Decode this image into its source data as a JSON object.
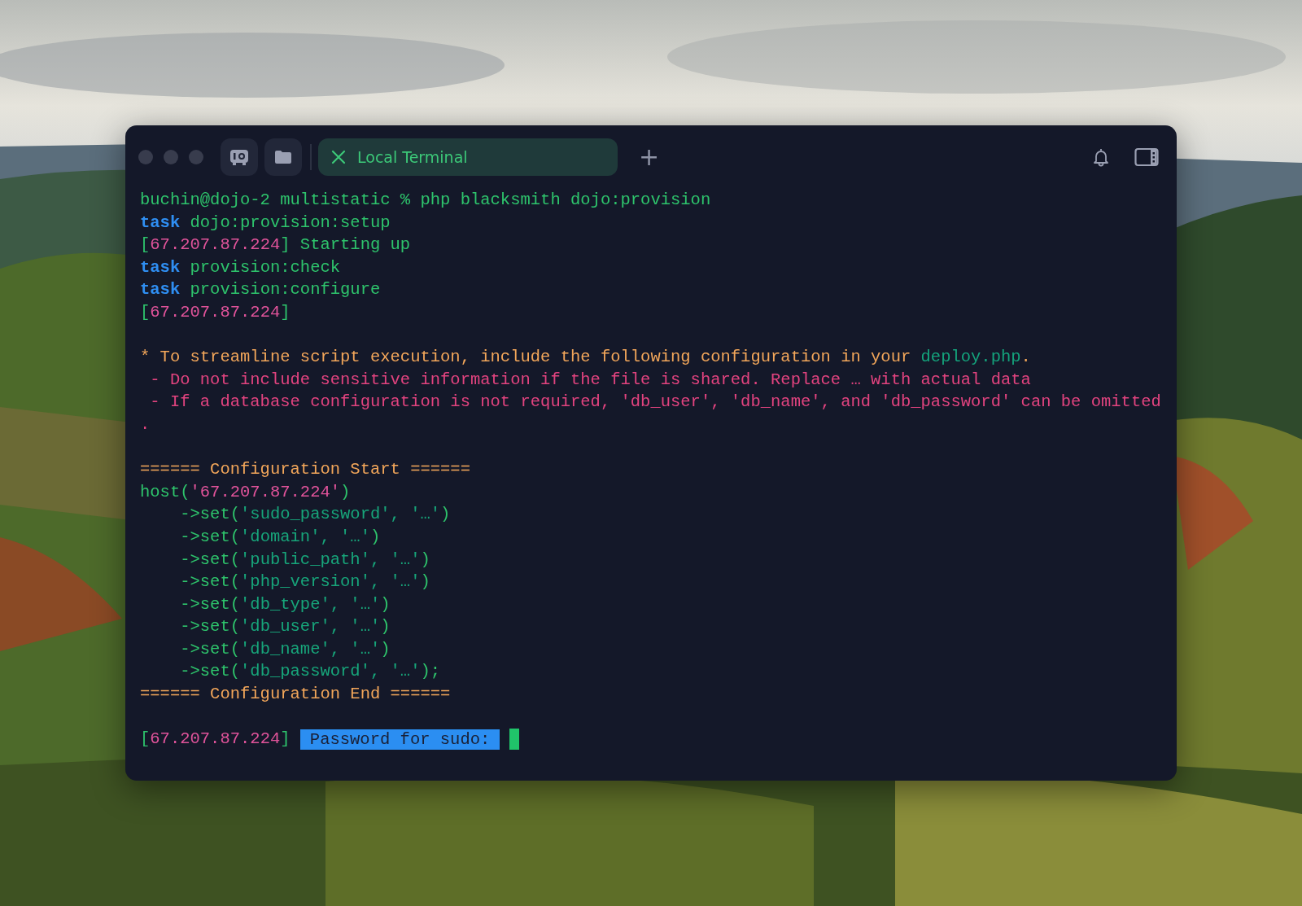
{
  "tab": {
    "label": "Local Terminal",
    "selected": true
  },
  "new_tab": {
    "label": "+"
  },
  "lines": [
    {
      "kind": "output",
      "segments": [
        {
          "kind": "text",
          "text": "buchin@dojo-2 multistatic % php blacksmith dojo:provision"
        }
      ]
    },
    {
      "kind": "output",
      "segments": [
        {
          "kind": "keyword",
          "text": "task"
        },
        {
          "kind": "text",
          "text": " dojo:provision:setup"
        }
      ]
    },
    {
      "kind": "output",
      "segments": [
        {
          "kind": "text",
          "text": "["
        },
        {
          "kind": "ip",
          "text": "67.207.87.224"
        },
        {
          "kind": "text",
          "text": "] Starting up"
        }
      ]
    },
    {
      "kind": "output",
      "segments": [
        {
          "kind": "keyword",
          "text": "task"
        },
        {
          "kind": "text",
          "text": " provision:check"
        }
      ]
    },
    {
      "kind": "output",
      "segments": [
        {
          "kind": "keyword",
          "text": "task"
        },
        {
          "kind": "text",
          "text": " provision:configure"
        }
      ]
    },
    {
      "kind": "output",
      "segments": [
        {
          "kind": "text",
          "text": "["
        },
        {
          "kind": "ip",
          "text": "67.207.87.224"
        },
        {
          "kind": "text",
          "text": "]"
        }
      ]
    },
    {
      "kind": "blank"
    },
    {
      "kind": "output",
      "segments": [
        {
          "kind": "notice",
          "text": "* To streamline script execution, include the following configuration in your "
        },
        {
          "kind": "file",
          "text": "deploy.php"
        },
        {
          "kind": "notice",
          "text": "."
        }
      ]
    },
    {
      "kind": "output",
      "segments": [
        {
          "kind": "warning",
          "text": " - Do not include sensitive information if the file is shared. Replace … with actual data"
        }
      ]
    },
    {
      "kind": "output",
      "segments": [
        {
          "kind": "warning",
          "text": " - If a database configuration is not required, 'db_user', 'db_name', and 'db_password' can be omitted"
        }
      ]
    },
    {
      "kind": "output",
      "segments": [
        {
          "kind": "warning",
          "text": "."
        }
      ]
    },
    {
      "kind": "blank"
    },
    {
      "kind": "output",
      "segments": [
        {
          "kind": "notice",
          "text": "====== Configuration Start ======"
        }
      ]
    },
    {
      "kind": "output",
      "segments": [
        {
          "kind": "text",
          "text": "host("
        },
        {
          "kind": "ip",
          "text": "'67.207.87.224'"
        },
        {
          "kind": "text",
          "text": ")"
        }
      ]
    },
    {
      "kind": "output",
      "segments": [
        {
          "kind": "text",
          "text": "    ->set("
        },
        {
          "kind": "string",
          "text": "'sudo_password', '…'"
        },
        {
          "kind": "text",
          "text": ")"
        }
      ]
    },
    {
      "kind": "output",
      "segments": [
        {
          "kind": "text",
          "text": "    ->set("
        },
        {
          "kind": "string",
          "text": "'domain', '…'"
        },
        {
          "kind": "text",
          "text": ")"
        }
      ]
    },
    {
      "kind": "output",
      "segments": [
        {
          "kind": "text",
          "text": "    ->set("
        },
        {
          "kind": "string",
          "text": "'public_path', '…'"
        },
        {
          "kind": "text",
          "text": ")"
        }
      ]
    },
    {
      "kind": "output",
      "segments": [
        {
          "kind": "text",
          "text": "    ->set("
        },
        {
          "kind": "string",
          "text": "'php_version', '…'"
        },
        {
          "kind": "text",
          "text": ")"
        }
      ]
    },
    {
      "kind": "output",
      "segments": [
        {
          "kind": "text",
          "text": "    ->set("
        },
        {
          "kind": "string",
          "text": "'db_type', '…'"
        },
        {
          "kind": "text",
          "text": ")"
        }
      ]
    },
    {
      "kind": "output",
      "segments": [
        {
          "kind": "text",
          "text": "    ->set("
        },
        {
          "kind": "string",
          "text": "'db_user', '…'"
        },
        {
          "kind": "text",
          "text": ")"
        }
      ]
    },
    {
      "kind": "output",
      "segments": [
        {
          "kind": "text",
          "text": "    ->set("
        },
        {
          "kind": "string",
          "text": "'db_name', '…'"
        },
        {
          "kind": "text",
          "text": ")"
        }
      ]
    },
    {
      "kind": "output",
      "segments": [
        {
          "kind": "text",
          "text": "    ->set("
        },
        {
          "kind": "string",
          "text": "'db_password', '…'"
        },
        {
          "kind": "text",
          "text": ");"
        }
      ]
    },
    {
      "kind": "output",
      "segments": [
        {
          "kind": "notice",
          "text": "====== Configuration End ======"
        }
      ]
    },
    {
      "kind": "blank"
    },
    {
      "kind": "output",
      "segments": [
        {
          "kind": "text",
          "text": "["
        },
        {
          "kind": "ip",
          "text": "67.207.87.224"
        },
        {
          "kind": "text",
          "text": "] "
        }
      ],
      "prompt": "Password for sudo:",
      "cursor": true
    }
  ]
}
